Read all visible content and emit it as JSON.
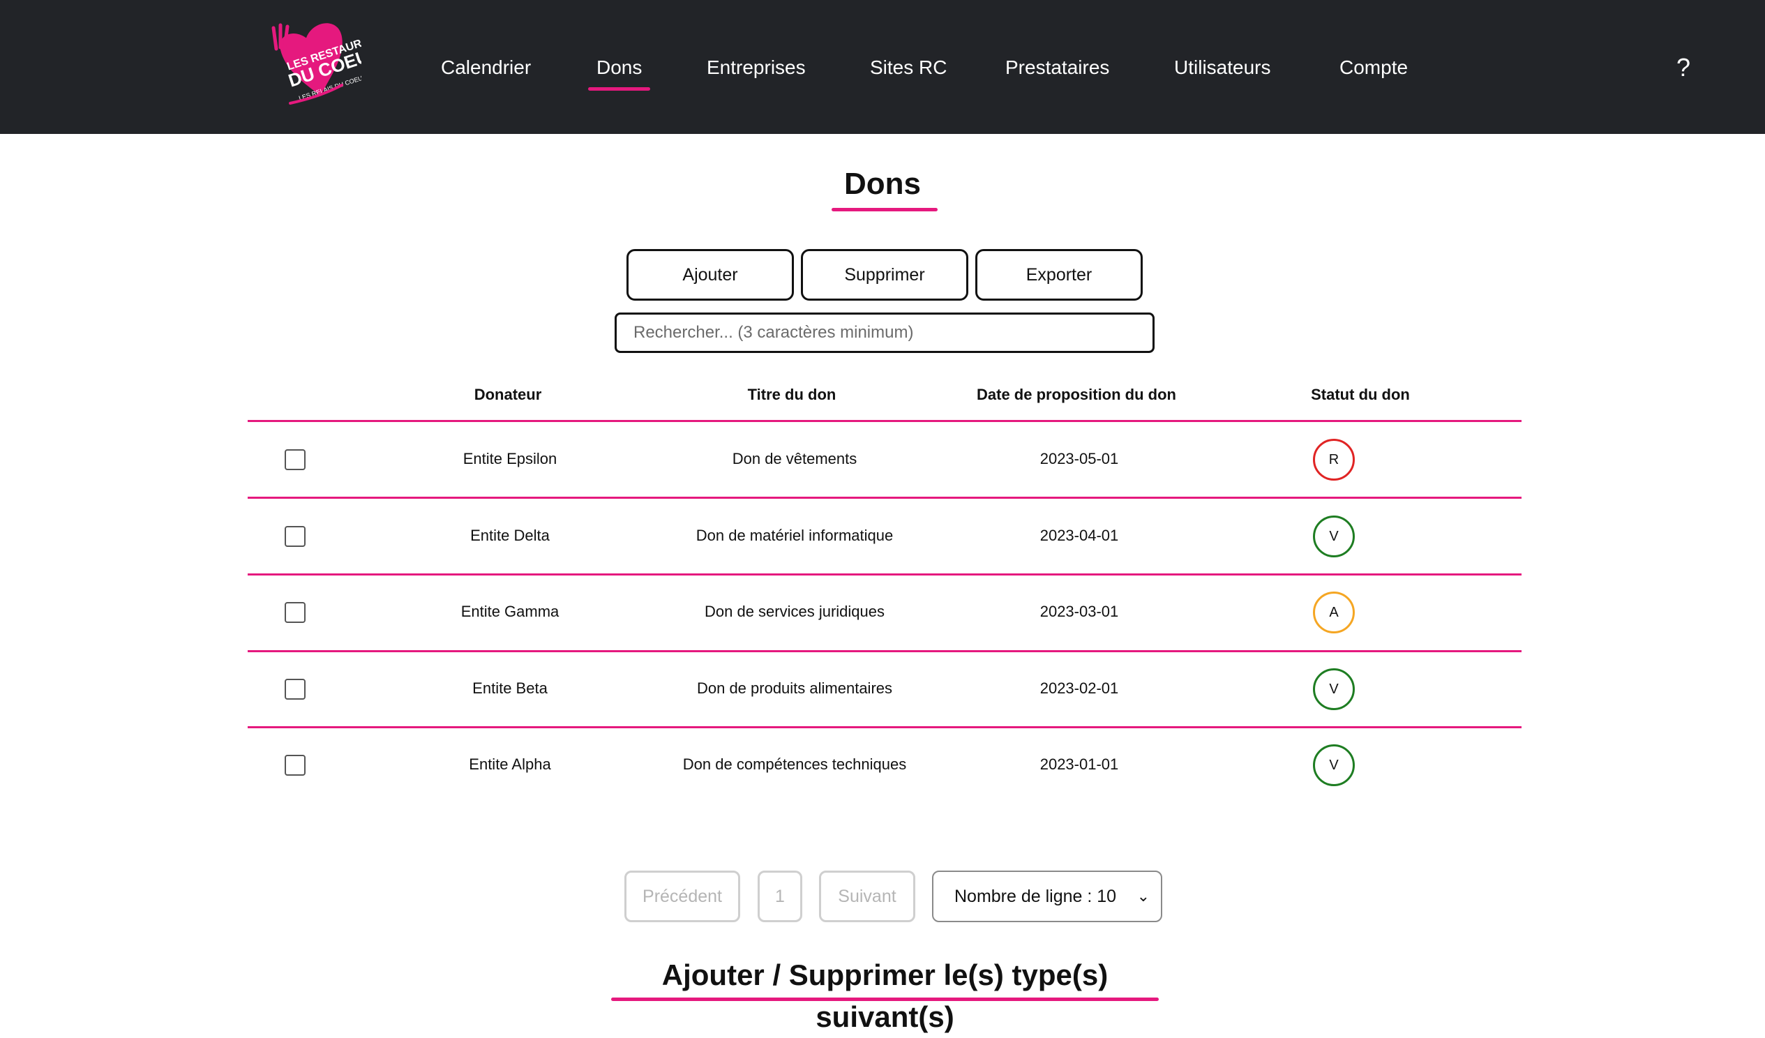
{
  "brand": {
    "logo_text_line1": "LES RESTAURANTS",
    "logo_text_line2": "DU COEUR",
    "logo_text_line3": "LES RELAIS DU COEUR",
    "accent_color": "#e5197e",
    "navbar_color": "#222428"
  },
  "nav": {
    "items": [
      {
        "label": "Calendrier",
        "active": false
      },
      {
        "label": "Dons",
        "active": true
      },
      {
        "label": "Entreprises",
        "active": false
      },
      {
        "label": "Sites RC",
        "active": false
      },
      {
        "label": "Prestataires",
        "active": false
      },
      {
        "label": "Utilisateurs",
        "active": false
      },
      {
        "label": "Compte",
        "active": false
      }
    ],
    "help_label": "?"
  },
  "page": {
    "title": "Dons"
  },
  "actions": {
    "add_label": "Ajouter",
    "delete_label": "Supprimer",
    "export_label": "Exporter"
  },
  "search": {
    "placeholder": "Rechercher... (3 caractères minimum)",
    "value": ""
  },
  "table": {
    "columns": [
      "Donateur",
      "Titre du don",
      "Date de proposition du don",
      "Statut du don"
    ],
    "rows": [
      {
        "donateur": "Entite Epsilon",
        "titre": "Don de vêtements",
        "date": "2023-05-01",
        "statut": "R",
        "statut_color": "#e02424",
        "checked": false
      },
      {
        "donateur": "Entite Delta",
        "titre": "Don de matériel informatique",
        "date": "2023-04-01",
        "statut": "V",
        "statut_color": "#1e7d22",
        "checked": false
      },
      {
        "donateur": "Entite Gamma",
        "titre": "Don de services juridiques",
        "date": "2023-03-01",
        "statut": "A",
        "statut_color": "#f5a623",
        "checked": false
      },
      {
        "donateur": "Entite Beta",
        "titre": "Don de produits alimentaires",
        "date": "2023-02-01",
        "statut": "V",
        "statut_color": "#1e7d22",
        "checked": false
      },
      {
        "donateur": "Entite Alpha",
        "titre": "Don de compétences techniques",
        "date": "2023-01-01",
        "statut": "V",
        "statut_color": "#1e7d22",
        "checked": false
      }
    ]
  },
  "pagination": {
    "prev_label": "Précédent",
    "page_label": "1",
    "next_label": "Suivant",
    "lines_label": "Nombre de ligne : 10"
  },
  "section": {
    "title": "Ajouter / Supprimer le(s) type(s) suivant(s)"
  }
}
